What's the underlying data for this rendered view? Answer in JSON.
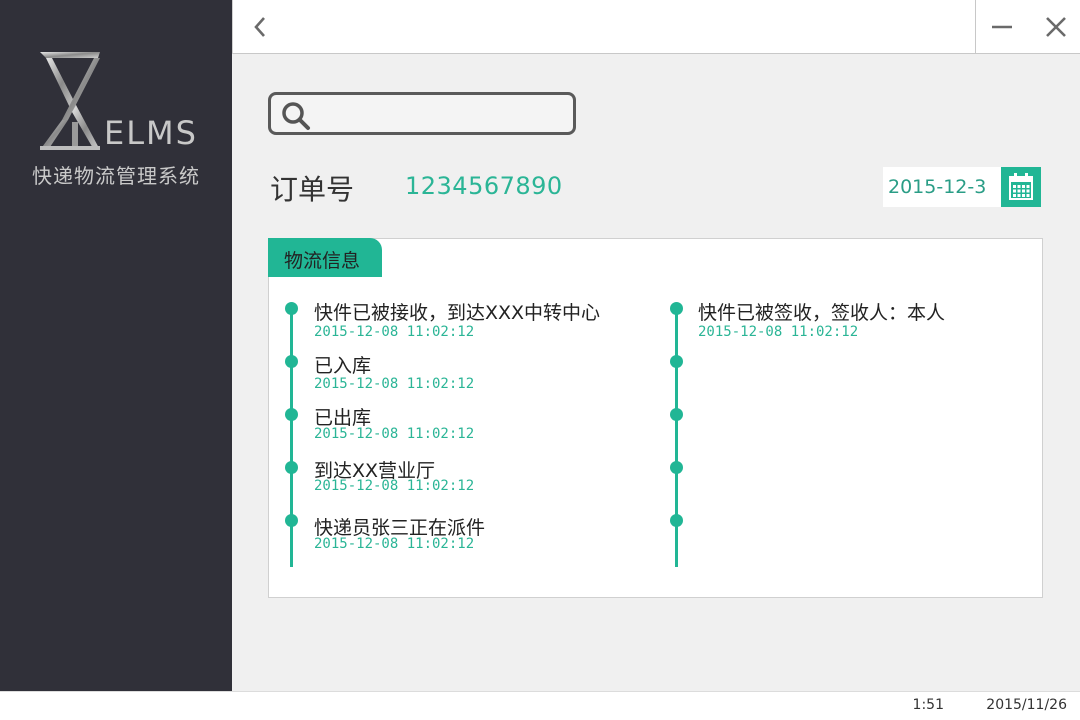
{
  "brand": {
    "logo_text": "ELMS",
    "app_name": "快递物流管理系统"
  },
  "search": {
    "value": "",
    "placeholder": ""
  },
  "order": {
    "label": "订单号",
    "number": "1234567890"
  },
  "date_filter": {
    "value": "2015-12-3"
  },
  "logistics": {
    "tab_label": "物流信息",
    "left_column": [
      {
        "title": "快件已被接收，到达XXX中转中心",
        "time": "2015-12-08 11:02:12"
      },
      {
        "title": "已入库",
        "time": "2015-12-08 11:02:12"
      },
      {
        "title": "已出库",
        "time": "2015-12-08 11:02:12"
      },
      {
        "title": "到达XX营业厅",
        "time": "2015-12-08 11:02:12"
      },
      {
        "title": "快递员张三正在派件",
        "time": "2015-12-08 11:02:12"
      }
    ],
    "right_column": [
      {
        "title": "快件已被签收，签收人：本人",
        "time": "2015-12-08 11:02:12"
      },
      {
        "title": "",
        "time": ""
      },
      {
        "title": "",
        "time": ""
      },
      {
        "title": "",
        "time": ""
      },
      {
        "title": "",
        "time": ""
      }
    ]
  },
  "status_bar": {
    "time": "1:51",
    "date": "2015/11/26"
  },
  "colors": {
    "accent": "#21b695",
    "sidebar": "#303039",
    "background": "#f0f0f0"
  },
  "icons": {
    "back": "chevron-left-icon",
    "minimize": "minimize-icon",
    "close": "close-icon",
    "search": "search-icon",
    "calendar": "calendar-icon"
  }
}
